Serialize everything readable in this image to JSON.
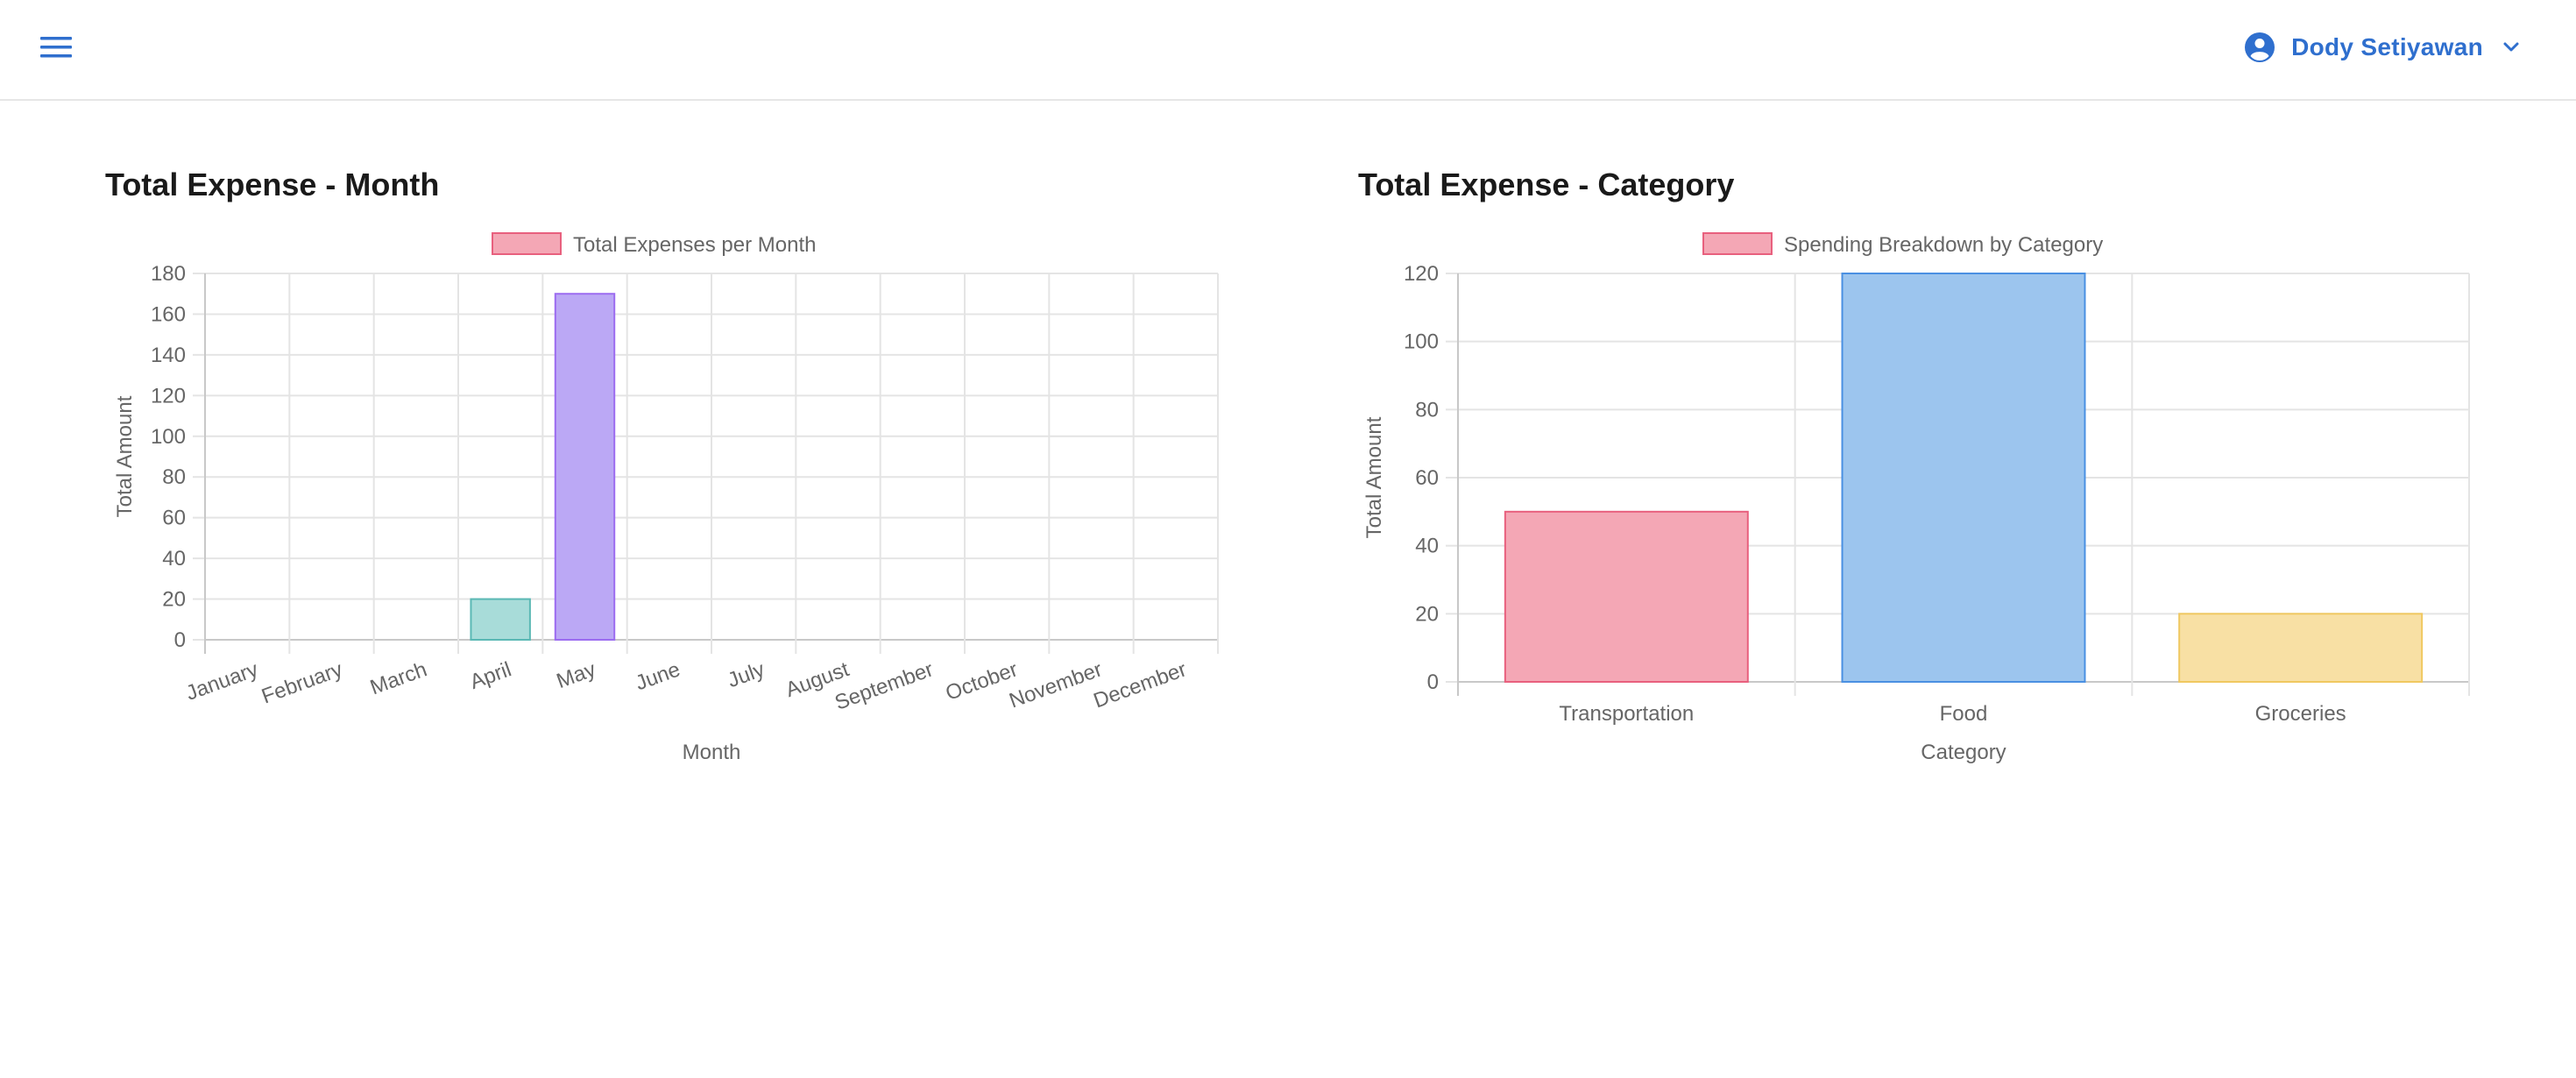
{
  "header": {
    "menu_icon": "hamburger-menu-icon",
    "user": {
      "name": "Dody Setiyawan",
      "avatar_icon": "account-circle-icon",
      "dropdown_icon": "chevron-down-icon"
    },
    "accent_color": "#2f6fce"
  },
  "panels": {
    "month": {
      "title": "Total Expense - Month"
    },
    "category": {
      "title": "Total Expense - Category"
    }
  },
  "chart_data": [
    {
      "type": "bar",
      "title": "Total Expense - Month",
      "legend": {
        "label": "Total Expenses per Month",
        "position": "top",
        "color": "#f4a7b5"
      },
      "xlabel": "Month",
      "ylabel": "Total Amount",
      "ylim": [
        0,
        180
      ],
      "yticks": [
        0,
        20,
        40,
        60,
        80,
        100,
        120,
        140,
        160,
        180
      ],
      "grid": true,
      "categories": [
        "January",
        "February",
        "March",
        "April",
        "May",
        "June",
        "July",
        "August",
        "September",
        "October",
        "November",
        "December"
      ],
      "values": [
        0,
        0,
        0,
        20,
        170,
        0,
        0,
        0,
        0,
        0,
        0,
        0
      ],
      "bar_colors": [
        "#f4a7b5",
        "#f4a7b5",
        "#f4a7b5",
        "#a8dcd9",
        "#bba8f5",
        "#f4a7b5",
        "#f4a7b5",
        "#f4a7b5",
        "#f4a7b5",
        "#f4a7b5",
        "#f4a7b5",
        "#f4a7b5"
      ],
      "border_colors": [
        "#e8607e",
        "#e8607e",
        "#e8607e",
        "#5ab8b4",
        "#9c6cf0",
        "#e8607e",
        "#e8607e",
        "#e8607e",
        "#e8607e",
        "#e8607e",
        "#e8607e",
        "#e8607e"
      ]
    },
    {
      "type": "bar",
      "title": "Total Expense - Category",
      "legend": {
        "label": "Spending Breakdown by Category",
        "position": "top",
        "color": "#f4a7b5"
      },
      "xlabel": "Category",
      "ylabel": "Total Amount",
      "ylim": [
        0,
        120
      ],
      "yticks": [
        0,
        20,
        40,
        60,
        80,
        100,
        120
      ],
      "grid": true,
      "categories": [
        "Transportation",
        "Food",
        "Groceries"
      ],
      "values": [
        50,
        120,
        20
      ],
      "bar_colors": [
        "#f4a7b5",
        "#9cc5ee",
        "#f8e0a4"
      ],
      "border_colors": [
        "#e8607e",
        "#4a90e2",
        "#f0c860"
      ]
    }
  ]
}
